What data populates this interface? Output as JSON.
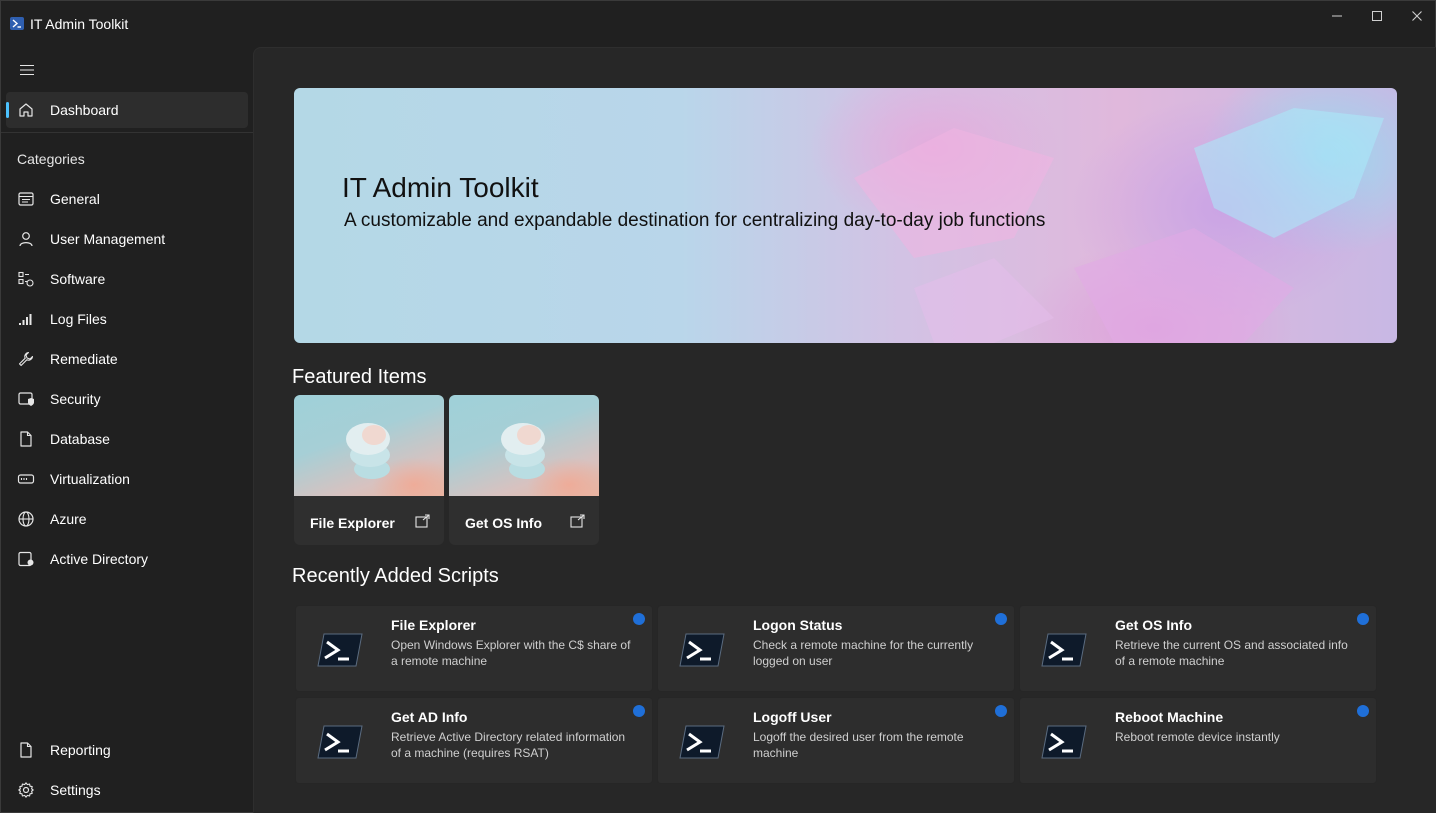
{
  "window": {
    "title": "IT Admin Toolkit"
  },
  "sidebar": {
    "top_item": {
      "label": "Dashboard",
      "icon": "home-icon"
    },
    "category_header": "Categories",
    "items": [
      {
        "label": "General",
        "icon": "general-icon"
      },
      {
        "label": "User Management",
        "icon": "user-icon"
      },
      {
        "label": "Software",
        "icon": "software-icon"
      },
      {
        "label": "Log Files",
        "icon": "log-files-icon"
      },
      {
        "label": "Remediate",
        "icon": "wrench-icon"
      },
      {
        "label": "Security",
        "icon": "security-icon"
      },
      {
        "label": "Database",
        "icon": "document-icon"
      },
      {
        "label": "Virtualization",
        "icon": "virtualization-icon"
      },
      {
        "label": "Azure",
        "icon": "globe-icon"
      },
      {
        "label": "Active Directory",
        "icon": "directory-icon"
      }
    ],
    "footer_items": [
      {
        "label": "Reporting",
        "icon": "report-icon"
      },
      {
        "label": "Settings",
        "icon": "gear-icon"
      }
    ]
  },
  "hero": {
    "title": "IT Admin Toolkit",
    "subtitle": "A customizable and expandable destination for centralizing day-to-day job functions"
  },
  "featured": {
    "title": "Featured Items",
    "items": [
      {
        "label": "File Explorer"
      },
      {
        "label": "Get OS Info"
      }
    ]
  },
  "recent": {
    "title": "Recently Added Scripts",
    "items": [
      {
        "title": "File Explorer",
        "description": "Open Windows Explorer with the C$ share of a remote machine"
      },
      {
        "title": "Logon Status",
        "description": "Check a remote machine for the currently logged on user"
      },
      {
        "title": "Get OS Info",
        "description": "Retrieve the current OS and associated info of a remote machine"
      },
      {
        "title": "Get AD Info",
        "description": "Retrieve Active Directory related information of a machine (requires RSAT)"
      },
      {
        "title": "Logoff User",
        "description": "Logoff the desired user from the remote machine"
      },
      {
        "title": "Reboot Machine",
        "description": "Reboot remote device instantly"
      }
    ]
  },
  "colors": {
    "accent": "#4cc2ff",
    "new_badge": "#1f6fd8",
    "background": "#202020",
    "content_background": "#272727"
  }
}
